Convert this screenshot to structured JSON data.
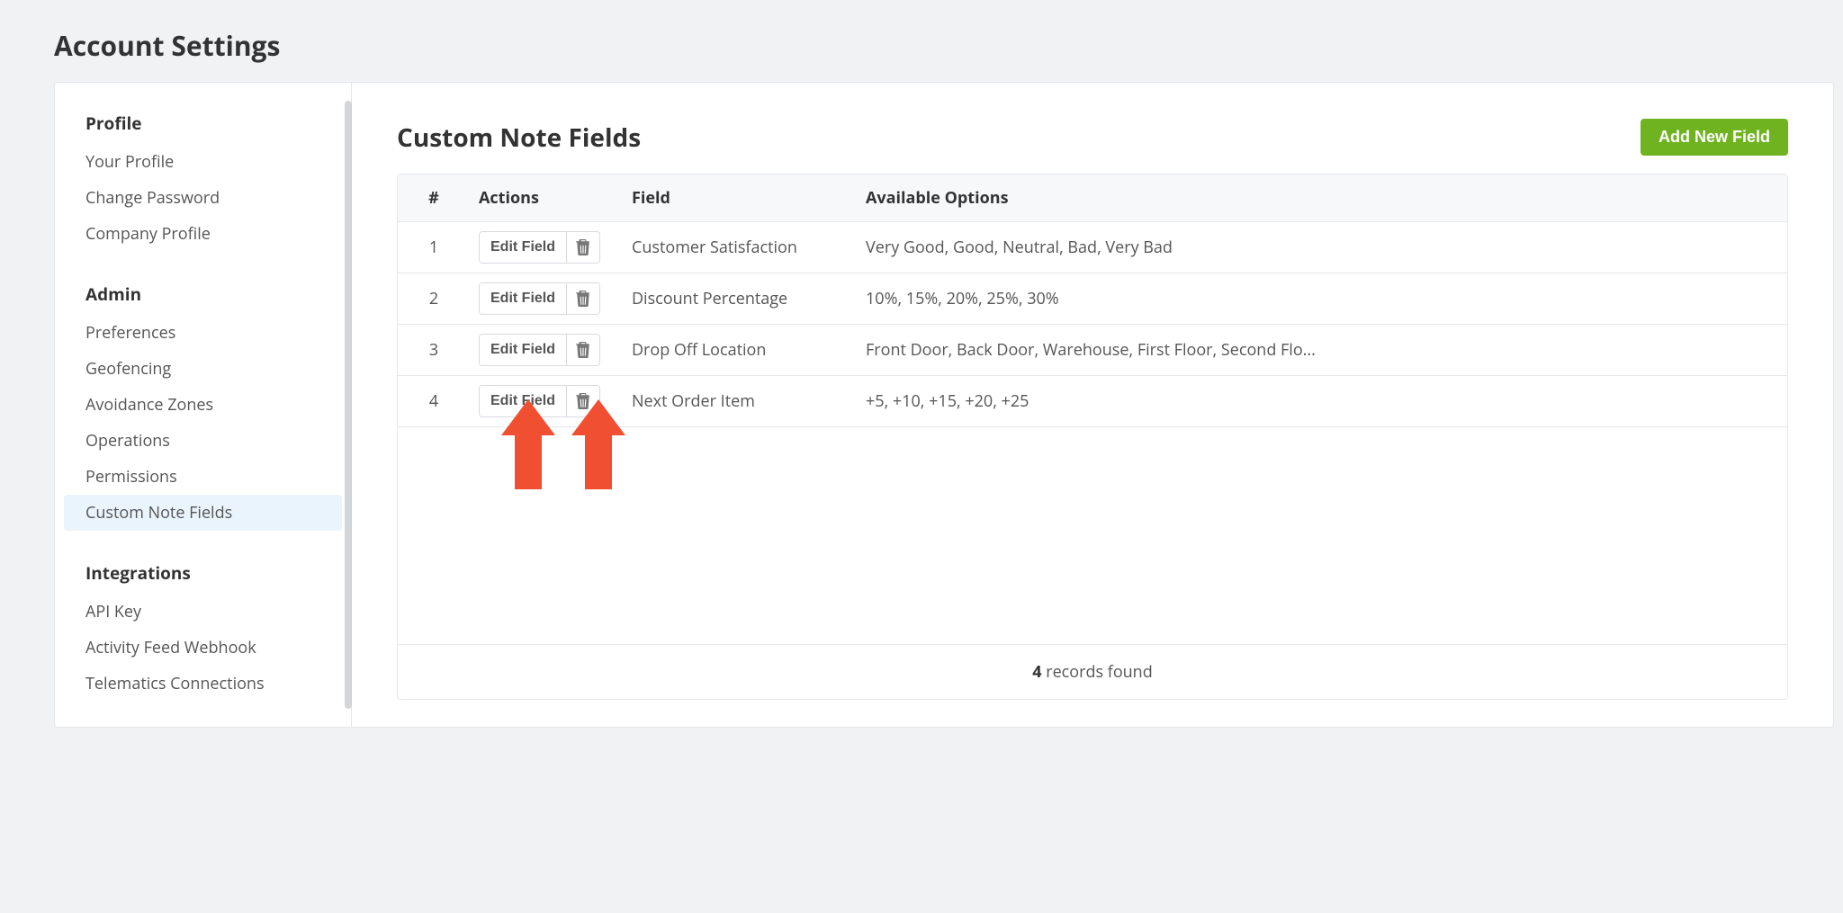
{
  "page_title": "Account Settings",
  "sidebar": {
    "sections": [
      {
        "title": "Profile",
        "items": [
          {
            "label": "Your Profile",
            "active": false
          },
          {
            "label": "Change Password",
            "active": false
          },
          {
            "label": "Company Profile",
            "active": false
          }
        ]
      },
      {
        "title": "Admin",
        "items": [
          {
            "label": "Preferences",
            "active": false
          },
          {
            "label": "Geofencing",
            "active": false
          },
          {
            "label": "Avoidance Zones",
            "active": false
          },
          {
            "label": "Operations",
            "active": false
          },
          {
            "label": "Permissions",
            "active": false
          },
          {
            "label": "Custom Note Fields",
            "active": true
          }
        ]
      },
      {
        "title": "Integrations",
        "items": [
          {
            "label": "API Key",
            "active": false
          },
          {
            "label": "Activity Feed Webhook",
            "active": false
          },
          {
            "label": "Telematics Connections",
            "active": false
          }
        ]
      }
    ]
  },
  "content": {
    "title": "Custom Note Fields",
    "add_button_label": "Add New Field",
    "columns": {
      "num": "#",
      "actions": "Actions",
      "field": "Field",
      "options": "Available Options"
    },
    "edit_label": "Edit Field",
    "rows": [
      {
        "num": "1",
        "field": "Customer Satisfaction",
        "options": "Very Good, Good, Neutral, Bad, Very Bad"
      },
      {
        "num": "2",
        "field": "Discount Percentage",
        "options": "10%, 15%, 20%, 25%, 30%"
      },
      {
        "num": "3",
        "field": "Drop Off Location",
        "options": "Front Door, Back Door, Warehouse, First Floor, Second Flo..."
      },
      {
        "num": "4",
        "field": "Next Order Item",
        "options": "+5, +10, +15, +20, +25"
      }
    ],
    "footer": {
      "count": "4",
      "text": " records found"
    }
  }
}
